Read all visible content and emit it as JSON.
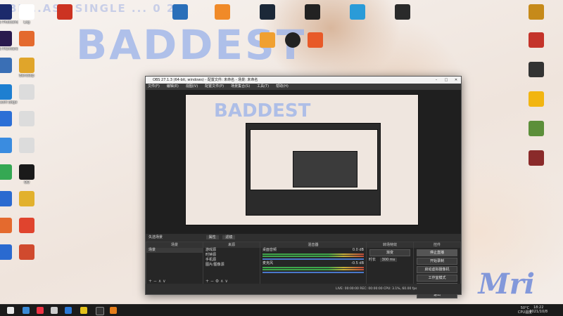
{
  "wallpaper": {
    "banner_top": "BE...ASE SINGLE ... 0 27",
    "banner_big": "BADDEST",
    "signature": "Mri"
  },
  "desktop_icons": [
    {
      "label": "Adobe Photoshop",
      "color": "#1c2a6b",
      "icon": "photoshop-icon"
    },
    {
      "label": "Adobe Premiere Pro",
      "color": "#2a1a4e",
      "icon": "premiere-icon"
    },
    {
      "label": "",
      "color": "#3a6fb5",
      "icon": "app-icon"
    },
    {
      "label": "Microsoft Edge",
      "color": "#1e7fd1",
      "icon": "edge-icon"
    },
    {
      "label": "",
      "color": "#2c6fd6",
      "icon": "app-icon"
    },
    {
      "label": "",
      "color": "#3a8ce0",
      "icon": "app-icon"
    },
    {
      "label": "",
      "color": "#35a853",
      "icon": "wechat-icon"
    },
    {
      "label": "",
      "color": "#2a6ad0",
      "icon": "app-icon"
    },
    {
      "label": "",
      "color": "#e46a2e",
      "icon": "app-icon"
    },
    {
      "label": "",
      "color": "#2a6ad0",
      "icon": "app-icon"
    },
    {
      "label": "Log",
      "color": "#ffffff",
      "icon": "file-icon"
    },
    {
      "label": "",
      "color": "#e46a2e",
      "icon": "app-icon"
    },
    {
      "label": "Bandizip",
      "color": "#e0a52a",
      "icon": "bandizip-icon"
    },
    {
      "label": "",
      "color": "#dcdcdc",
      "icon": "app-icon"
    },
    {
      "label": "",
      "color": "#dcdcdc",
      "icon": "app-icon"
    },
    {
      "label": "",
      "color": "#dcdcdc",
      "icon": "app-icon"
    },
    {
      "label": "QQ",
      "color": "#1a1a1a",
      "icon": "qq-icon"
    },
    {
      "label": "",
      "color": "#e2b12d",
      "icon": "app-icon"
    },
    {
      "label": "",
      "color": "#e0442e",
      "icon": "app-icon"
    },
    {
      "label": "",
      "color": "#d04a2e",
      "icon": "app-icon"
    }
  ],
  "taskbar": {
    "tray_temp": "50°C",
    "tray_cpu": "CPU温度",
    "time": "18:22",
    "date": "2021/10/8"
  },
  "obs": {
    "title": "OBS 27.1.3 (64-bit, windows) - 配置文件: 未命名 - 场景: 未命名",
    "menu": [
      "文件(F)",
      "编辑(E)",
      "视图(V)",
      "配置文件(P)",
      "场景集合(S)",
      "工具(T)",
      "帮助(H)"
    ],
    "scene_status": "失选场景",
    "scene_buttons": [
      "属性",
      "滤镜"
    ],
    "panels": {
      "scenes": {
        "title": "场景",
        "items": [
          "场景"
        ]
      },
      "sources": {
        "title": "来源",
        "items": [
          "游戏源",
          "时钟源",
          "手机源",
          "图片/图像源"
        ]
      },
      "mixer": {
        "title": "混音器",
        "tracks": [
          {
            "name": "桌面音频",
            "db": "0.0 dB"
          },
          {
            "name": "麦克风",
            "db": "-0.5 dB"
          }
        ]
      },
      "transitions": {
        "title": "转场特效",
        "type": "渐变",
        "duration_label": "时长",
        "duration": "300 ms"
      },
      "controls": {
        "title": "控件",
        "buttons": [
          "停止直播",
          "开始录制",
          "启动虚拟摄像机",
          "工作室模式",
          "设置",
          "退出"
        ]
      }
    },
    "status": "LIVE: 00:00:00   REC: 00:00:00   CPU: 3.1%, 60.00 fps"
  }
}
